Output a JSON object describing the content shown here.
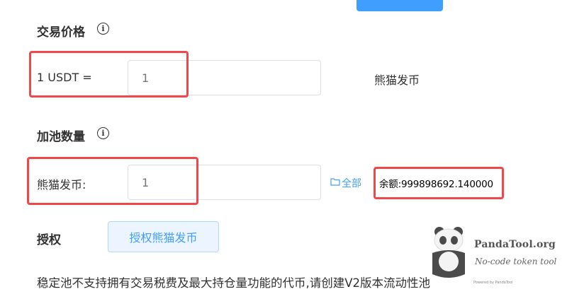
{
  "price_section": {
    "label": "交易价格",
    "info_icon": "info-icon",
    "prefix": "1 USDT =",
    "input_placeholder": "1",
    "unit": "熊猫发币"
  },
  "pool_section": {
    "label": "加池数量",
    "info_icon": "info-icon",
    "token_label": "熊猫发币:",
    "input_placeholder": "1",
    "all_button": "全部",
    "all_icon": "folder-icon",
    "balance": "余额:999898692.140000"
  },
  "approve_section": {
    "label": "授权",
    "button": "授权熊猫发币"
  },
  "notice": "稳定池不支持拥有交易税费及最大持仓量功能的代币,请创建V2版本流动性池",
  "watermark": {
    "title": "PandaTool.org",
    "subtitle": "No-code token tool",
    "powered": "Powered by PandaTool"
  },
  "colors": {
    "primary": "#409eff",
    "highlight_box": "#f0474b",
    "text": "#303133",
    "placeholder": "#c0c4cc"
  }
}
